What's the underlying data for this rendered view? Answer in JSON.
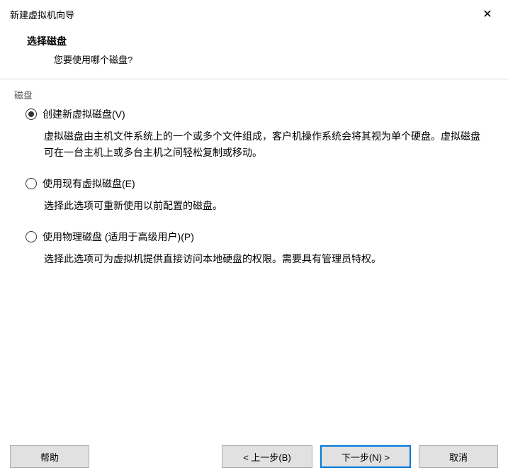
{
  "window": {
    "title": "新建虚拟机向导"
  },
  "header": {
    "title": "选择磁盘",
    "subtitle": "您要使用哪个磁盘?"
  },
  "fieldset": {
    "label": "磁盘"
  },
  "options": {
    "create": {
      "label": "创建新虚拟磁盘(V)",
      "desc": "虚拟磁盘由主机文件系统上的一个或多个文件组成，客户机操作系统会将其视为单个硬盘。虚拟磁盘可在一台主机上或多台主机之间轻松复制或移动。",
      "selected": true
    },
    "existing": {
      "label": "使用现有虚拟磁盘(E)",
      "desc": "选择此选项可重新使用以前配置的磁盘。",
      "selected": false
    },
    "physical": {
      "label": "使用物理磁盘 (适用于高级用户)(P)",
      "desc": "选择此选项可为虚拟机提供直接访问本地硬盘的权限。需要具有管理员特权。",
      "selected": false
    }
  },
  "buttons": {
    "help": "帮助",
    "back": "< 上一步(B)",
    "next": "下一步(N) >",
    "cancel": "取消"
  }
}
